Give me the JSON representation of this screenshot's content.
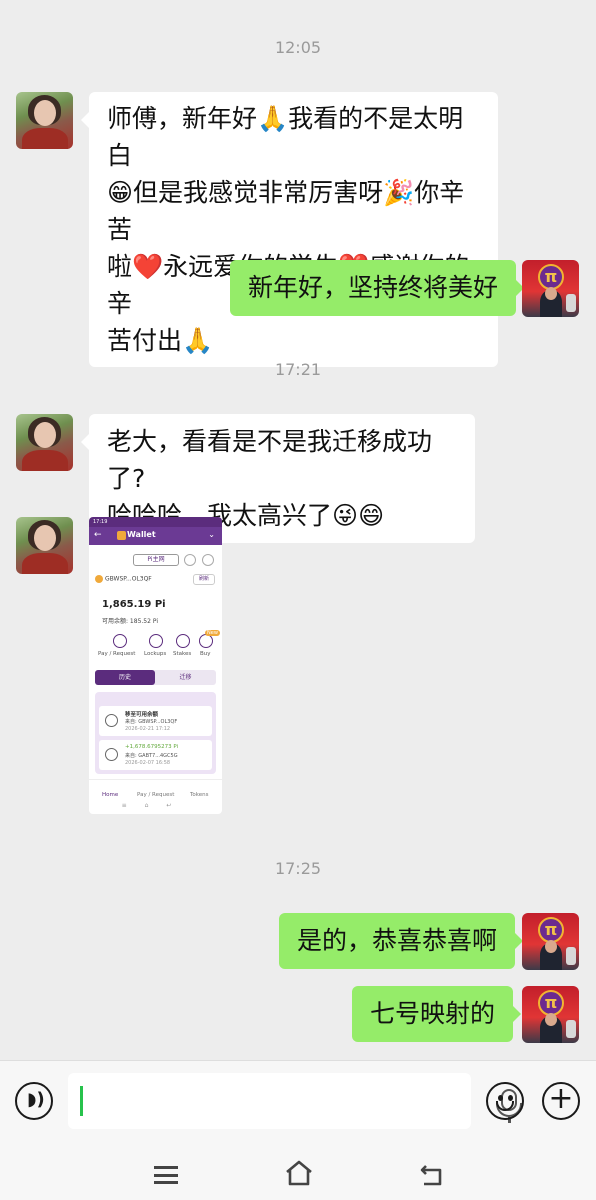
{
  "chat": {
    "time_1": "12:05",
    "time_2": "17:21",
    "time_3": "17:25",
    "msg_1": {
      "line_1": "师傅，新年好🙏我看的不是太明白",
      "line_2": "😁但是我感觉非常厉害呀🎉你辛苦",
      "line_3": "啦❤️永远爱你的学生❤️感谢你的辛",
      "line_4": "苦付出🙏"
    },
    "msg_2": "新年好，坚持终将美好",
    "msg_3": {
      "line_1": "老大，看看是不是我迁移成功了?",
      "line_2": "哈哈哈，我太高兴了😜😄"
    },
    "msg_5": "是的，恭喜恭喜啊",
    "msg_6": "七号映射的"
  },
  "wallet_screenshot": {
    "status_time": "17:19",
    "app_title": "Wallet",
    "network": "Pi主网",
    "address": "GBWSP...OL3QF",
    "refresh_label": "刷新",
    "balance": "1,865.19 Pi",
    "available": "可用余额: 185.52 Pi",
    "actions": [
      "Pay / Request",
      "Lockups",
      "Stakes",
      "Buy"
    ],
    "new_badge": "New",
    "tab_history": "历史",
    "tab_migrate": "迁移",
    "transactions": [
      {
        "title": "移至可用余额",
        "from": "来自: GBWSP...OL3QF",
        "date": "2026-02-21 17:12"
      },
      {
        "title": "+1,678.6795273 Pi",
        "from": "来自: GABT7...4GC5G",
        "date": "2026-02-07 16:58"
      }
    ],
    "nav": [
      "Home",
      "Pay / Request",
      "Tokens"
    ]
  },
  "input_bar": {
    "text": ""
  },
  "icons": {
    "voice": "voice-icon",
    "mic": "mic-icon",
    "emoji": "emoji-icon",
    "plus": "plus-icon",
    "menu": "menu-icon",
    "home": "home-icon",
    "back": "back-icon"
  },
  "colors": {
    "bubble_sent": "#95ec69",
    "bubble_received": "#ffffff",
    "background": "#ededed",
    "wallet_purple": "#5b2c7d"
  }
}
